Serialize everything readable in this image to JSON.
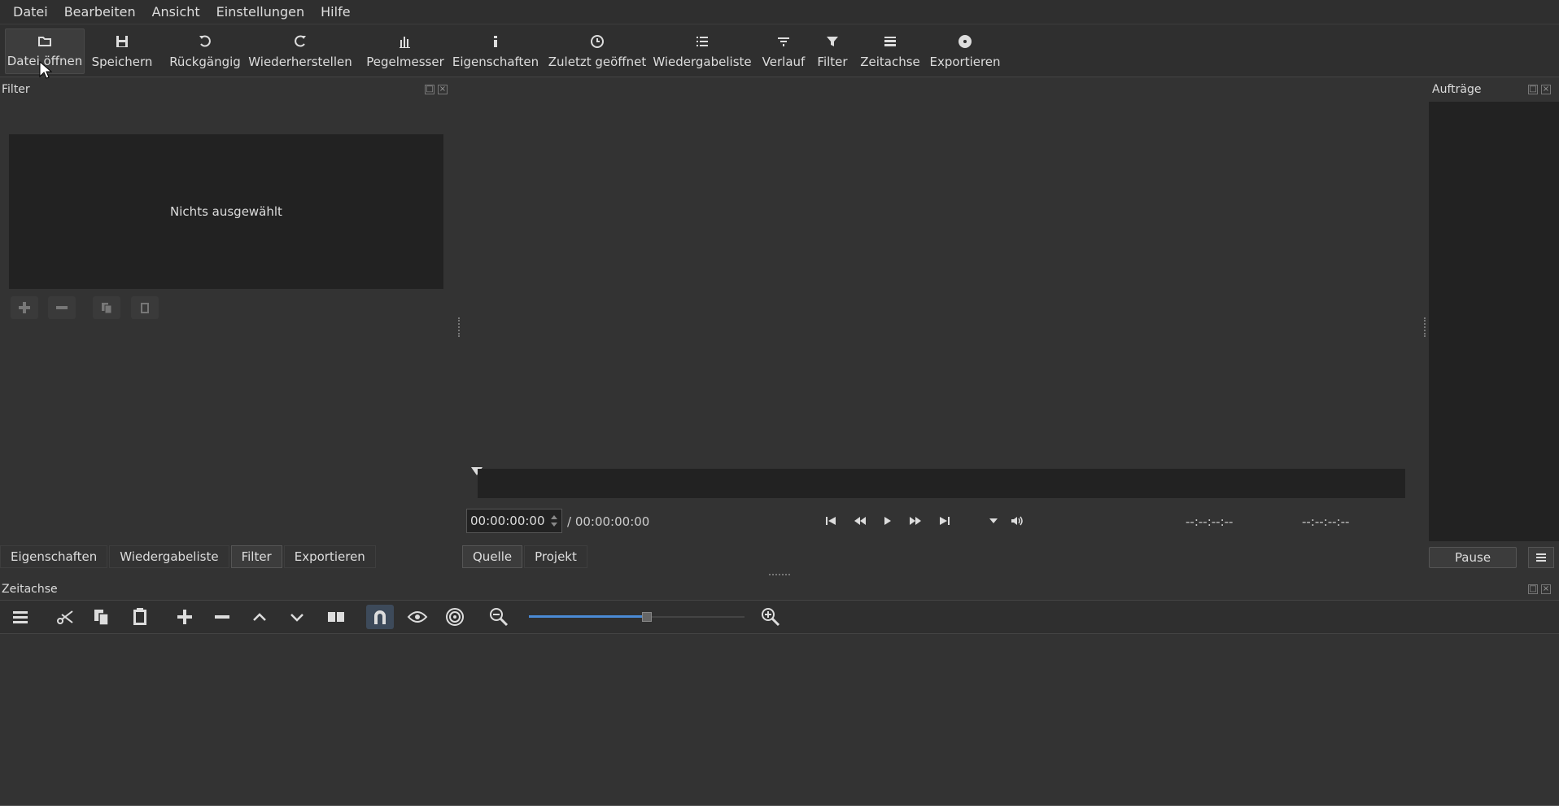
{
  "menu": {
    "items": [
      "Datei",
      "Bearbeiten",
      "Ansicht",
      "Einstellungen",
      "Hilfe"
    ]
  },
  "toolbar": {
    "open": "Datei öffnen",
    "save": "Speichern",
    "undo": "Rückgängig",
    "redo": "Wiederherstellen",
    "meter": "Pegelmesser",
    "properties": "Eigenschaften",
    "recent": "Zuletzt geöffnet",
    "playlist": "Wiedergabeliste",
    "history": "Verlauf",
    "filter": "Filter",
    "timeline": "Zeitachse",
    "export": "Exportieren"
  },
  "filter_panel": {
    "title": "Filter",
    "empty_text": "Nichts ausgewählt"
  },
  "left_tabs": [
    "Eigenschaften",
    "Wiedergabeliste",
    "Filter",
    "Exportieren"
  ],
  "player": {
    "position": "00:00:00:00",
    "duration": "/ 00:00:00:00",
    "in_point": "--:--:--:--",
    "out_point": "--:--:--:--",
    "tabs": [
      "Quelle",
      "Projekt"
    ]
  },
  "jobs_panel": {
    "title": "Aufträge",
    "pause": "Pause"
  },
  "timeline_panel": {
    "title": "Zeitachse",
    "zoom_level": 0.55
  },
  "colors": {
    "accent": "#4a8ad4",
    "bg": "#333333"
  }
}
